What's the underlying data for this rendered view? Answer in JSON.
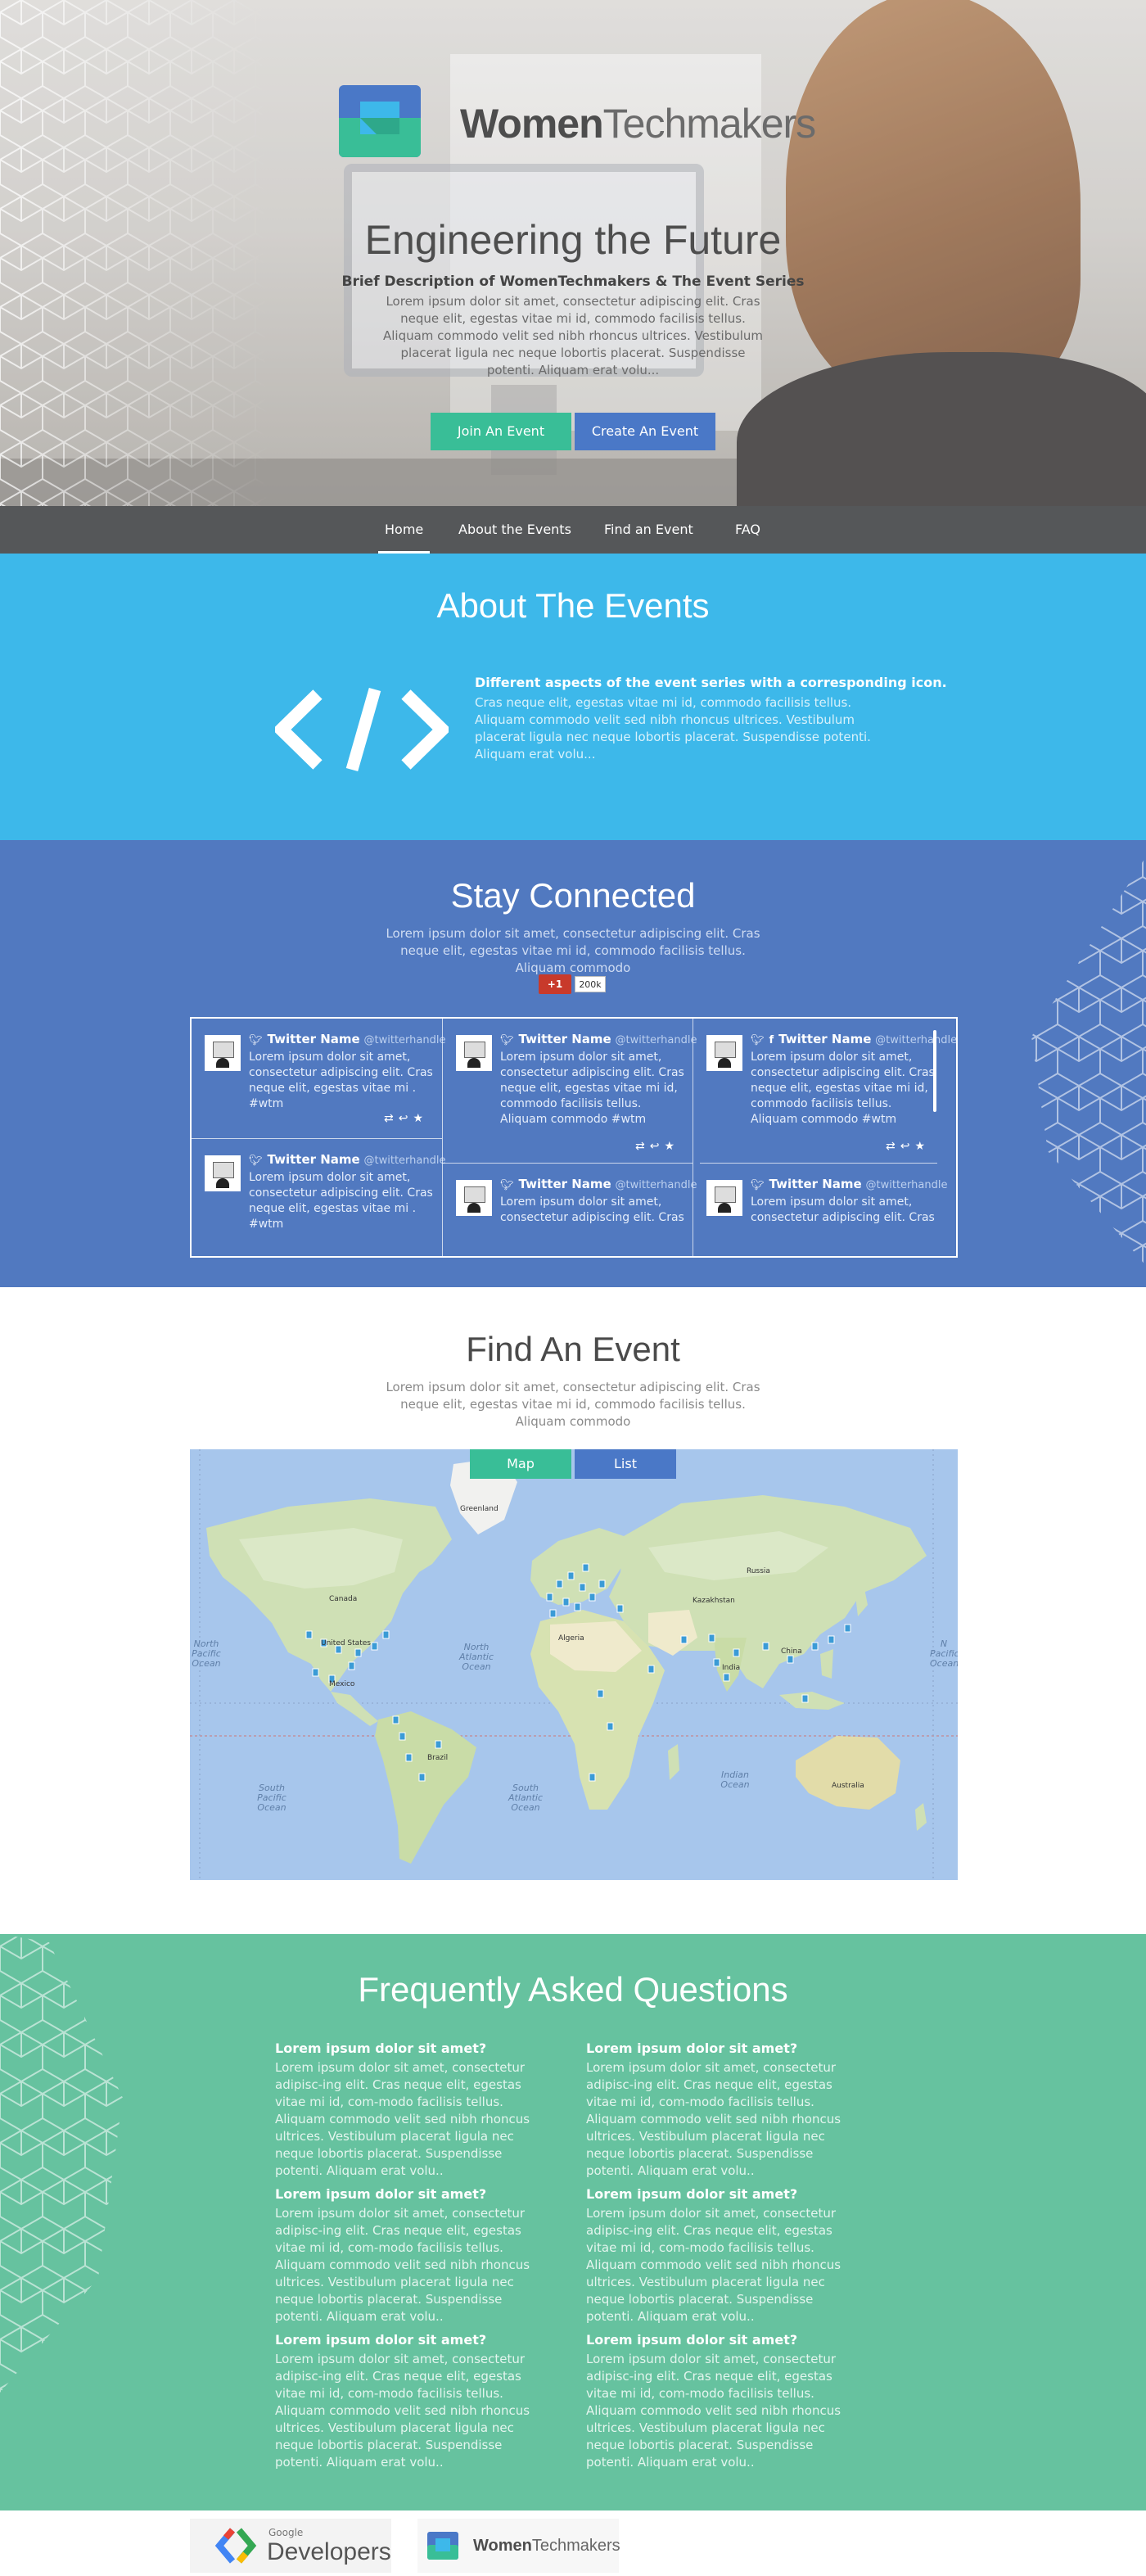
{
  "hero": {
    "brand_bold": "Women",
    "brand_rest": "Techmakers",
    "title": "Engineering the Future",
    "subtitle": "Brief Description of WomenTechmakers & The Event Series",
    "description": "Lorem ipsum dolor sit amet, consectetur adipiscing elit. Cras neque elit, egestas vitae mi id, commodo facilisis tellus. Aliquam commodo velit sed nibh rhoncus ultrices. Vestibulum placerat ligula nec neque lobortis placerat. Suspendisse potenti. Aliquam erat volu...",
    "join_label": "Join An Event",
    "create_label": "Create An Event"
  },
  "nav": {
    "items": [
      "Home",
      "About the Events",
      "Find an Event",
      "FAQ"
    ],
    "active": "Home"
  },
  "about": {
    "title": "About The Events",
    "heading": "Different aspects of the event series with a corresponding icon.",
    "body": "Cras neque elit, egestas vitae mi id, commodo facilisis tellus. Aliquam commodo velit sed nibh rhoncus ultrices. Vestibulum placerat ligula nec neque lobortis placerat. Suspendisse potenti. Aliquam erat volu..."
  },
  "stay": {
    "title": "Stay Connected",
    "description": "Lorem ipsum dolor sit amet, consectetur adipiscing elit. Cras neque elit, egestas vitae mi id, commodo facilisis tellus. Aliquam commodo",
    "gplus_label": "+1",
    "gplus_count": "200k",
    "tweets": [
      {
        "name": "Twitter Name",
        "handle": "@twitterhandle",
        "text": "Lorem ipsum dolor sit amet, consectetur adipiscing elit. Cras neque elit, egestas vitae mi . #wtm"
      },
      {
        "name": "Twitter Name",
        "handle": "@twitterhandle",
        "text": "Lorem ipsum dolor sit amet, consectetur adipiscing elit. Cras neque elit, egestas vitae mi . #wtm"
      },
      {
        "name": "Twitter Name",
        "handle": "@twitterhandle",
        "text": "Lorem ipsum dolor sit amet, consectetur adipiscing elit. Cras neque elit, egestas vitae mi id, commodo facilisis tellus. Aliquam commodo #wtm"
      },
      {
        "name": "Twitter Name",
        "handle": "@twitterhandle",
        "text": "Lorem ipsum dolor sit amet, consectetur adipiscing elit. Cras"
      },
      {
        "name": "Twitter Name",
        "handle": "@twitterhandle",
        "text": "Lorem ipsum dolor sit amet, consectetur adipiscing elit. Cras neque elit, egestas vitae mi id, commodo facilisis tellus. Aliquam commodo #wtm"
      },
      {
        "name": "Twitter Name",
        "handle": "@twitterhandle",
        "text": "Lorem ipsum dolor sit amet, consectetur adipiscing elit. Cras"
      }
    ]
  },
  "find": {
    "title": "Find An Event",
    "description": "Lorem ipsum dolor sit amet, consectetur adipiscing elit. Cras neque elit, egestas vitae mi id, commodo facilisis tellus. Aliquam commodo",
    "tab_map": "Map",
    "tab_list": "List",
    "oceans": {
      "north_pacific": "North Pacific Ocean",
      "north_atlantic": "North Atlantic Ocean",
      "south_pacific": "South Pacific Ocean",
      "south_atlantic": "South Atlantic Ocean",
      "indian": "Indian Ocean",
      "north_pacific_right": "N Pacific Ocean"
    },
    "places": {
      "greenland": "Greenland",
      "canada": "Canada",
      "us": "United States",
      "mexico": "Mexico",
      "brazil": "Brazil",
      "russia": "Russia",
      "china": "China",
      "india": "India",
      "australia": "Australia",
      "algeria": "Algeria",
      "kazakhstan": "Kazakhstan"
    }
  },
  "faq": {
    "title": "Frequently Asked Questions",
    "items": [
      {
        "q": "Lorem ipsum dolor sit amet?",
        "a": "Lorem ipsum dolor sit amet, consectetur adipisc-ing elit. Cras neque elit, egestas vitae mi id, com-modo facilisis tellus. Aliquam commodo velit sed nibh rhoncus ultrices. Vestibulum placerat ligula nec neque lobortis placerat. Suspendisse potenti. Aliquam erat volu.."
      },
      {
        "q": "Lorem ipsum dolor sit amet?",
        "a": "Lorem ipsum dolor sit amet, consectetur adipisc-ing elit. Cras neque elit, egestas vitae mi id, com-modo facilisis tellus. Aliquam commodo velit sed nibh rhoncus ultrices. Vestibulum placerat ligula nec neque lobortis placerat. Suspendisse potenti. Aliquam erat volu.."
      },
      {
        "q": "Lorem ipsum dolor sit amet?",
        "a": "Lorem ipsum dolor sit amet, consectetur adipisc-ing elit. Cras neque elit, egestas vitae mi id, com-modo facilisis tellus. Aliquam commodo velit sed nibh rhoncus ultrices. Vestibulum placerat ligula nec neque lobortis placerat. Suspendisse potenti. Aliquam erat volu.."
      },
      {
        "q": "Lorem ipsum dolor sit amet?",
        "a": "Lorem ipsum dolor sit amet, consectetur adipisc-ing elit. Cras neque elit, egestas vitae mi id, com-modo facilisis tellus. Aliquam commodo velit sed nibh rhoncus ultrices. Vestibulum placerat ligula nec neque lobortis placerat. Suspendisse potenti. Aliquam erat volu.."
      },
      {
        "q": "Lorem ipsum dolor sit amet?",
        "a": "Lorem ipsum dolor sit amet, consectetur adipisc-ing elit. Cras neque elit, egestas vitae mi id, com-modo facilisis tellus. Aliquam commodo velit sed nibh rhoncus ultrices. Vestibulum placerat ligula nec neque lobortis placerat. Suspendisse potenti. Aliquam erat volu.."
      },
      {
        "q": "Lorem ipsum dolor sit amet?",
        "a": "Lorem ipsum dolor sit amet, consectetur adipisc-ing elit. Cras neque elit, egestas vitae mi id, com-modo facilisis tellus. Aliquam commodo velit sed nibh rhoncus ultrices. Vestibulum placerat ligula nec neque lobortis placerat. Suspendisse potenti. Aliquam erat volu.."
      }
    ]
  },
  "footer": {
    "google_small": "Google",
    "developers": "Developers",
    "wtm_bold": "Women",
    "wtm_rest": "Techmakers"
  },
  "colors": {
    "green": "#39be97",
    "blue": "#4a78c7",
    "about_bg": "#3db8ea",
    "stay_bg": "#5179c0",
    "faq_bg": "#66c29f",
    "nav_bg": "#555759"
  },
  "icons": [
    "code-icon",
    "twitter-icon",
    "facebook-icon",
    "retweet-icon",
    "reply-icon",
    "favorite-icon",
    "google-plus-icon",
    "map-marker-icon"
  ]
}
